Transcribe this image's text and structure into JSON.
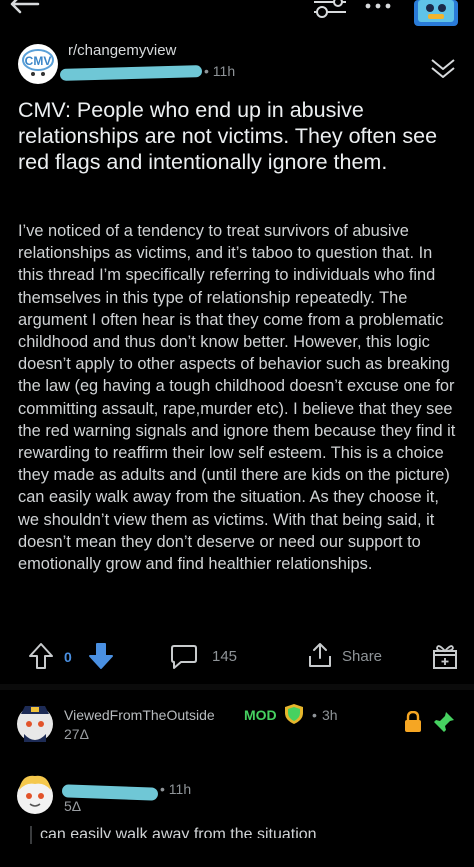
{
  "post": {
    "subreddit": "r/changemyview",
    "time": "11h",
    "title": "CMV: People who end up in abusive relationships are not victims. They often see red flags and intentionally ignore them.",
    "body": "I’ve noticed of a tendency to treat survivors of abusive relationships as victims, and it’s taboo to question that. In this thread I’m specifically referring to individuals who find themselves in this type of relationship repeatedly. The argument I often hear is that they come from a problematic childhood and thus don’t know better. However, this logic doesn’t apply to other aspects of behavior such as breaking the law (eg having a tough childhood doesn’t excuse one for committing assault, rape,murder etc). I believe that they see the red warning signals and ignore them because they find it rewarding to reaffirm their low self esteem. This is a choice they made as adults and (until there are kids on the picture) can easily walk away from the situation. As they choose it, we shouldn’t view them as victims. With that being said, it doesn’t mean they don’t deserve or need our support to emotionally grow and find healthier relationships."
  },
  "actions": {
    "vote_count": "0",
    "comment_count": "145",
    "share_label": "Share"
  },
  "comments": [
    {
      "username": "ViewedFromTheOutside",
      "mod_label": "MOD",
      "separator": "•",
      "time": "3h",
      "karma": "27Δ"
    },
    {
      "time": "11h",
      "karma": "5Δ",
      "quote": "can easily walk away from the situation"
    }
  ],
  "colors": {
    "background": "#000000",
    "accent_blue": "#4a90e2",
    "mod_green": "#46d160",
    "redaction": "#6fc7d6"
  },
  "icons": {
    "back": "back-arrow-icon",
    "filter": "filter-icon",
    "more": "more-dots-icon",
    "collapse": "chevron-double-down-icon",
    "upvote": "upvote-icon",
    "downvote": "downvote-icon",
    "comment": "comment-bubble-icon",
    "share": "share-icon",
    "award": "award-icon",
    "lock": "lock-icon",
    "pin": "pin-icon"
  }
}
